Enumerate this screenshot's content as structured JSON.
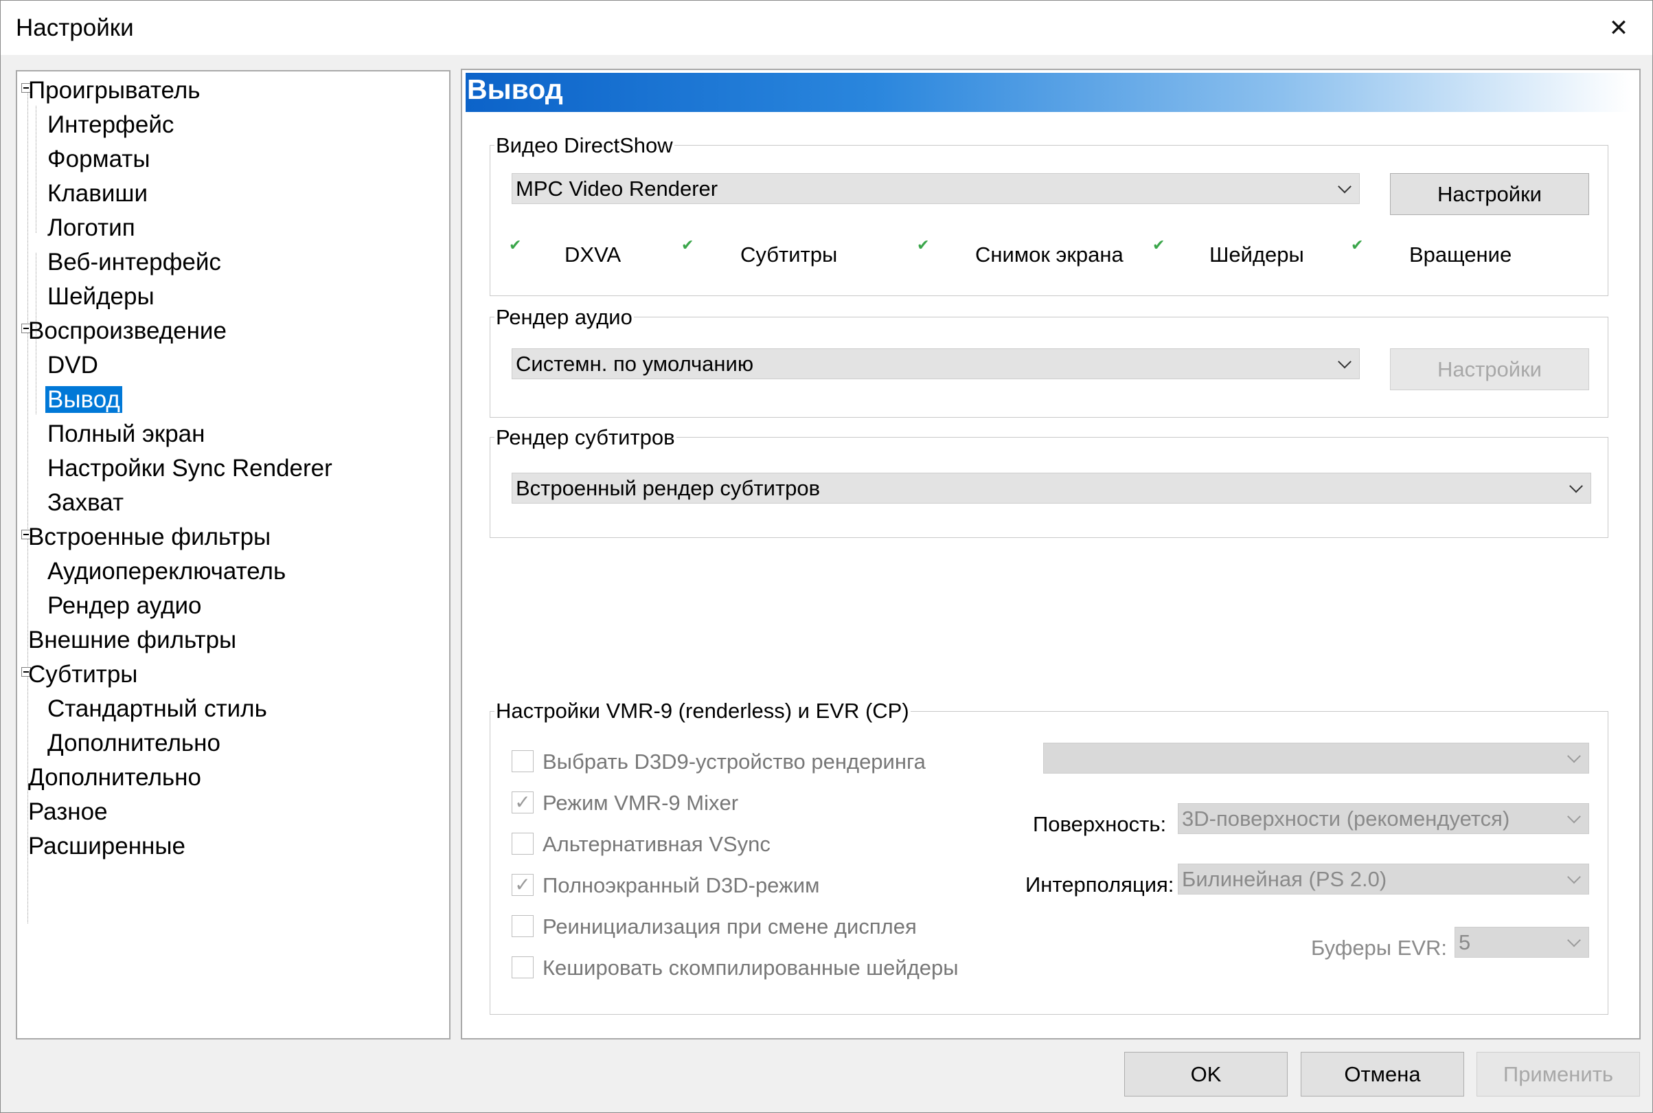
{
  "window": {
    "title": "Настройки",
    "close_glyph": "✕"
  },
  "tree": {
    "items": [
      {
        "label": "Проигрыватель"
      },
      {
        "label": "Интерфейс"
      },
      {
        "label": "Форматы"
      },
      {
        "label": "Клавиши"
      },
      {
        "label": "Логотип"
      },
      {
        "label": "Веб-интерфейс"
      },
      {
        "label": "Шейдеры"
      },
      {
        "label": "Воспроизведение"
      },
      {
        "label": "DVD"
      },
      {
        "label": "Вывод"
      },
      {
        "label": "Полный экран"
      },
      {
        "label": "Настройки Sync Renderer"
      },
      {
        "label": "Захват"
      },
      {
        "label": "Встроенные фильтры"
      },
      {
        "label": "Аудиопереключатель"
      },
      {
        "label": "Рендер аудио"
      },
      {
        "label": "Внешние фильтры"
      },
      {
        "label": "Субтитры"
      },
      {
        "label": "Стандартный стиль"
      },
      {
        "label": "Дополнительно"
      },
      {
        "label": "Дополнительно"
      },
      {
        "label": "Разное"
      },
      {
        "label": "Расширенные"
      }
    ],
    "selected": "Вывод"
  },
  "page": {
    "heading": "Вывод"
  },
  "video": {
    "group_label": "Видео DirectShow",
    "renderer_value": "MPC Video Renderer",
    "settings_label": "Настройки",
    "tick_glyph": "✔",
    "features": [
      "DXVA",
      "Субтитры",
      "Снимок экрана",
      "Шейдеры",
      "Вращение"
    ]
  },
  "audio": {
    "group_label": "Рендер аудио",
    "renderer_value": "Системн. по умолчанию",
    "settings_label": "Настройки"
  },
  "subtitles": {
    "group_label": "Рендер субтитров",
    "renderer_value": "Встроенный рендер субтитров"
  },
  "vmr": {
    "group_label": "Настройки VMR-9 (renderless) и EVR (CP)",
    "check_glyph": "✓",
    "checkboxes": [
      {
        "label": "Выбрать D3D9-устройство рендеринга",
        "checked": false
      },
      {
        "label": "Режим VMR-9 Mixer",
        "checked": true
      },
      {
        "label": "Альтернативная VSync",
        "checked": false
      },
      {
        "label": "Полноэкранный D3D-режим",
        "checked": true
      },
      {
        "label": "Реинициализация при смене дисплея",
        "checked": false
      },
      {
        "label": "Кешировать скомпилированные шейдеры",
        "checked": false
      }
    ],
    "device_value": "",
    "surface_label": "Поверхность:",
    "surface_value": "3D-поверхности (рекомендуется)",
    "interp_label": "Интерполяция:",
    "interp_value": "Билинейная (PS 2.0)",
    "buffers_label": "Буферы EVR:",
    "buffers_value": "5"
  },
  "footer": {
    "ok": "OK",
    "cancel": "Отмена",
    "apply": "Применить"
  }
}
